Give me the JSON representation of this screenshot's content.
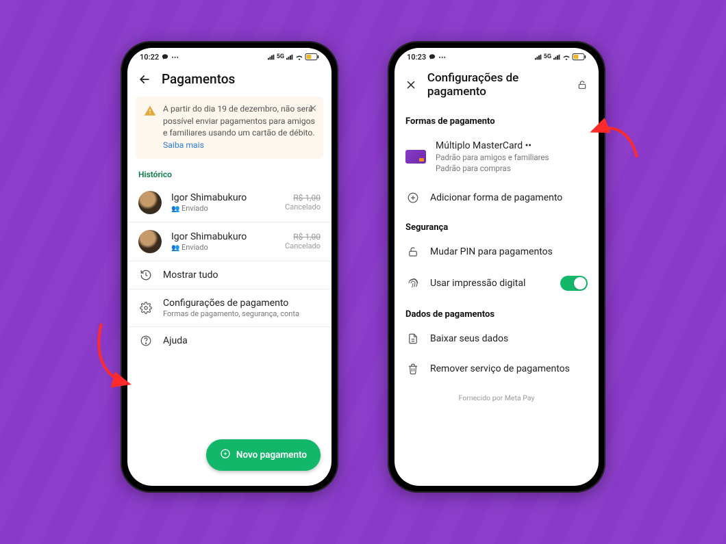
{
  "statusbar": {
    "time_left": "10:22",
    "time_right": "10:23",
    "net_label": "5G"
  },
  "phone1": {
    "title": "Pagamentos",
    "alert_text": "A partir do dia 19 de dezembro, não será possível enviar pagamentos para amigos e familiares usando um cartão de débito. ",
    "alert_link": "Saiba mais",
    "history_label": "Histórico",
    "history": [
      {
        "name": "Igor Shimabukuro",
        "sub": "Enviado",
        "amount": "R$ 1,00",
        "status": "Cancelado"
      },
      {
        "name": "Igor Shimabukuro",
        "sub": "Enviado",
        "amount": "R$ 1,00",
        "status": "Cancelado"
      }
    ],
    "show_all": "Mostrar tudo",
    "settings_title": "Configurações de pagamento",
    "settings_sub": "Formas de pagamento, segurança, conta",
    "help": "Ajuda",
    "fab": "Novo pagamento"
  },
  "phone2": {
    "title": "Configurações de pagamento",
    "section_methods": "Formas de pagamento",
    "card_name": "Múltiplo MasterCard ••",
    "card_sub1": "Padrão para amigos e familiares",
    "card_sub2": "Padrão para compras",
    "add_method": "Adicionar forma de pagamento",
    "section_security": "Segurança",
    "change_pin": "Mudar PIN para pagamentos",
    "fingerprint": "Usar impressão digital",
    "section_data": "Dados de pagamentos",
    "download": "Baixar seus dados",
    "remove": "Remover serviço de pagamentos",
    "footer": "Fornecido por Meta Pay"
  }
}
